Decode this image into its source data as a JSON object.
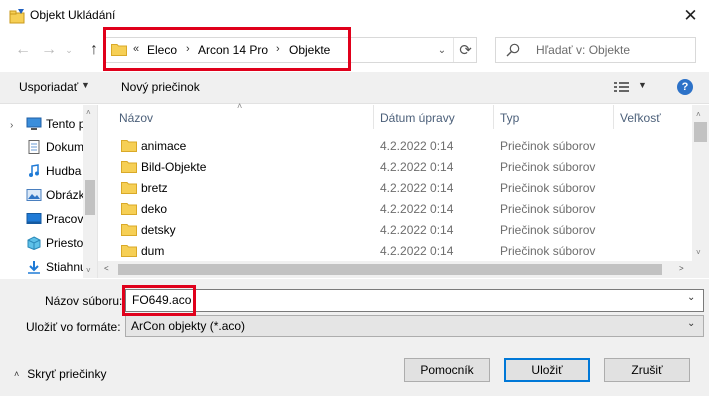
{
  "window": {
    "title": "Objekt Ukládání",
    "close_glyph": "✕"
  },
  "nav": {
    "back_glyph": "←",
    "forward_glyph": "→",
    "recent_glyph": "⌄",
    "up_glyph": "↑"
  },
  "address": {
    "overflow_glyph": "«",
    "crumbs": [
      "Eleco",
      "Arcon 14 Pro",
      "Objekte"
    ],
    "separator": "›",
    "dropdown_glyph": "⌄",
    "refresh_glyph": "⟳"
  },
  "search": {
    "placeholder": "Hľadať v: Objekte"
  },
  "toolbar": {
    "organize_label": "Usporiadať",
    "organize_dd": "▼",
    "new_folder_label": "Nový priečinok",
    "view_dd": "▼",
    "help_glyph": "?"
  },
  "navpane": {
    "collapse_glyph": "›",
    "items": [
      {
        "label": "Tento počítač",
        "icon": "computer-icon"
      },
      {
        "label": "Dokumenty",
        "icon": "documents-icon"
      },
      {
        "label": "Hudba",
        "icon": "music-icon"
      },
      {
        "label": "Obrázky",
        "icon": "pictures-icon"
      },
      {
        "label": "Pracovná plocha",
        "icon": "desktop-icon"
      },
      {
        "label": "Priestorové objekty",
        "icon": "3d-objects-icon"
      },
      {
        "label": "Stiahnuté súbory",
        "icon": "downloads-icon"
      }
    ],
    "scroll_up": "˄",
    "scroll_down": "˅"
  },
  "filelist": {
    "columns": {
      "name": "Názov",
      "date": "Dátum úpravy",
      "type": "Typ",
      "size": "Veľkosť"
    },
    "sort_glyph": "˄",
    "rows": [
      {
        "name": "animace",
        "date": "4.2.2022 0:14",
        "type": "Priečinok súborov"
      },
      {
        "name": "Bild-Objekte",
        "date": "4.2.2022 0:14",
        "type": "Priečinok súborov"
      },
      {
        "name": "bretz",
        "date": "4.2.2022 0:14",
        "type": "Priečinok súborov"
      },
      {
        "name": "deko",
        "date": "4.2.2022 0:14",
        "type": "Priečinok súborov"
      },
      {
        "name": "detsky",
        "date": "4.2.2022 0:14",
        "type": "Priečinok súborov"
      },
      {
        "name": "dum",
        "date": "4.2.2022 0:14",
        "type": "Priečinok súborov"
      }
    ],
    "scroll_up": "˄",
    "scroll_down": "˅",
    "scroll_left": "<",
    "scroll_right": ">"
  },
  "form": {
    "filename_label": "Názov súboru:",
    "filename_value": "FO649.aco",
    "filename_dd": "⌄",
    "format_label": "Uložiť vo formáte:",
    "format_value": "ArCon objekty (*.aco)",
    "format_dd": "⌄"
  },
  "footer": {
    "hide_folders_glyph": "˄",
    "hide_folders_label": "Skryť priečinky",
    "help_button": "Pomocník",
    "save_button": "Uložiť",
    "cancel_button": "Zrušiť"
  },
  "colors": {
    "highlight_red": "#e0001b",
    "folder_yellow": "#f6cf55",
    "accent_blue": "#0078d7"
  }
}
